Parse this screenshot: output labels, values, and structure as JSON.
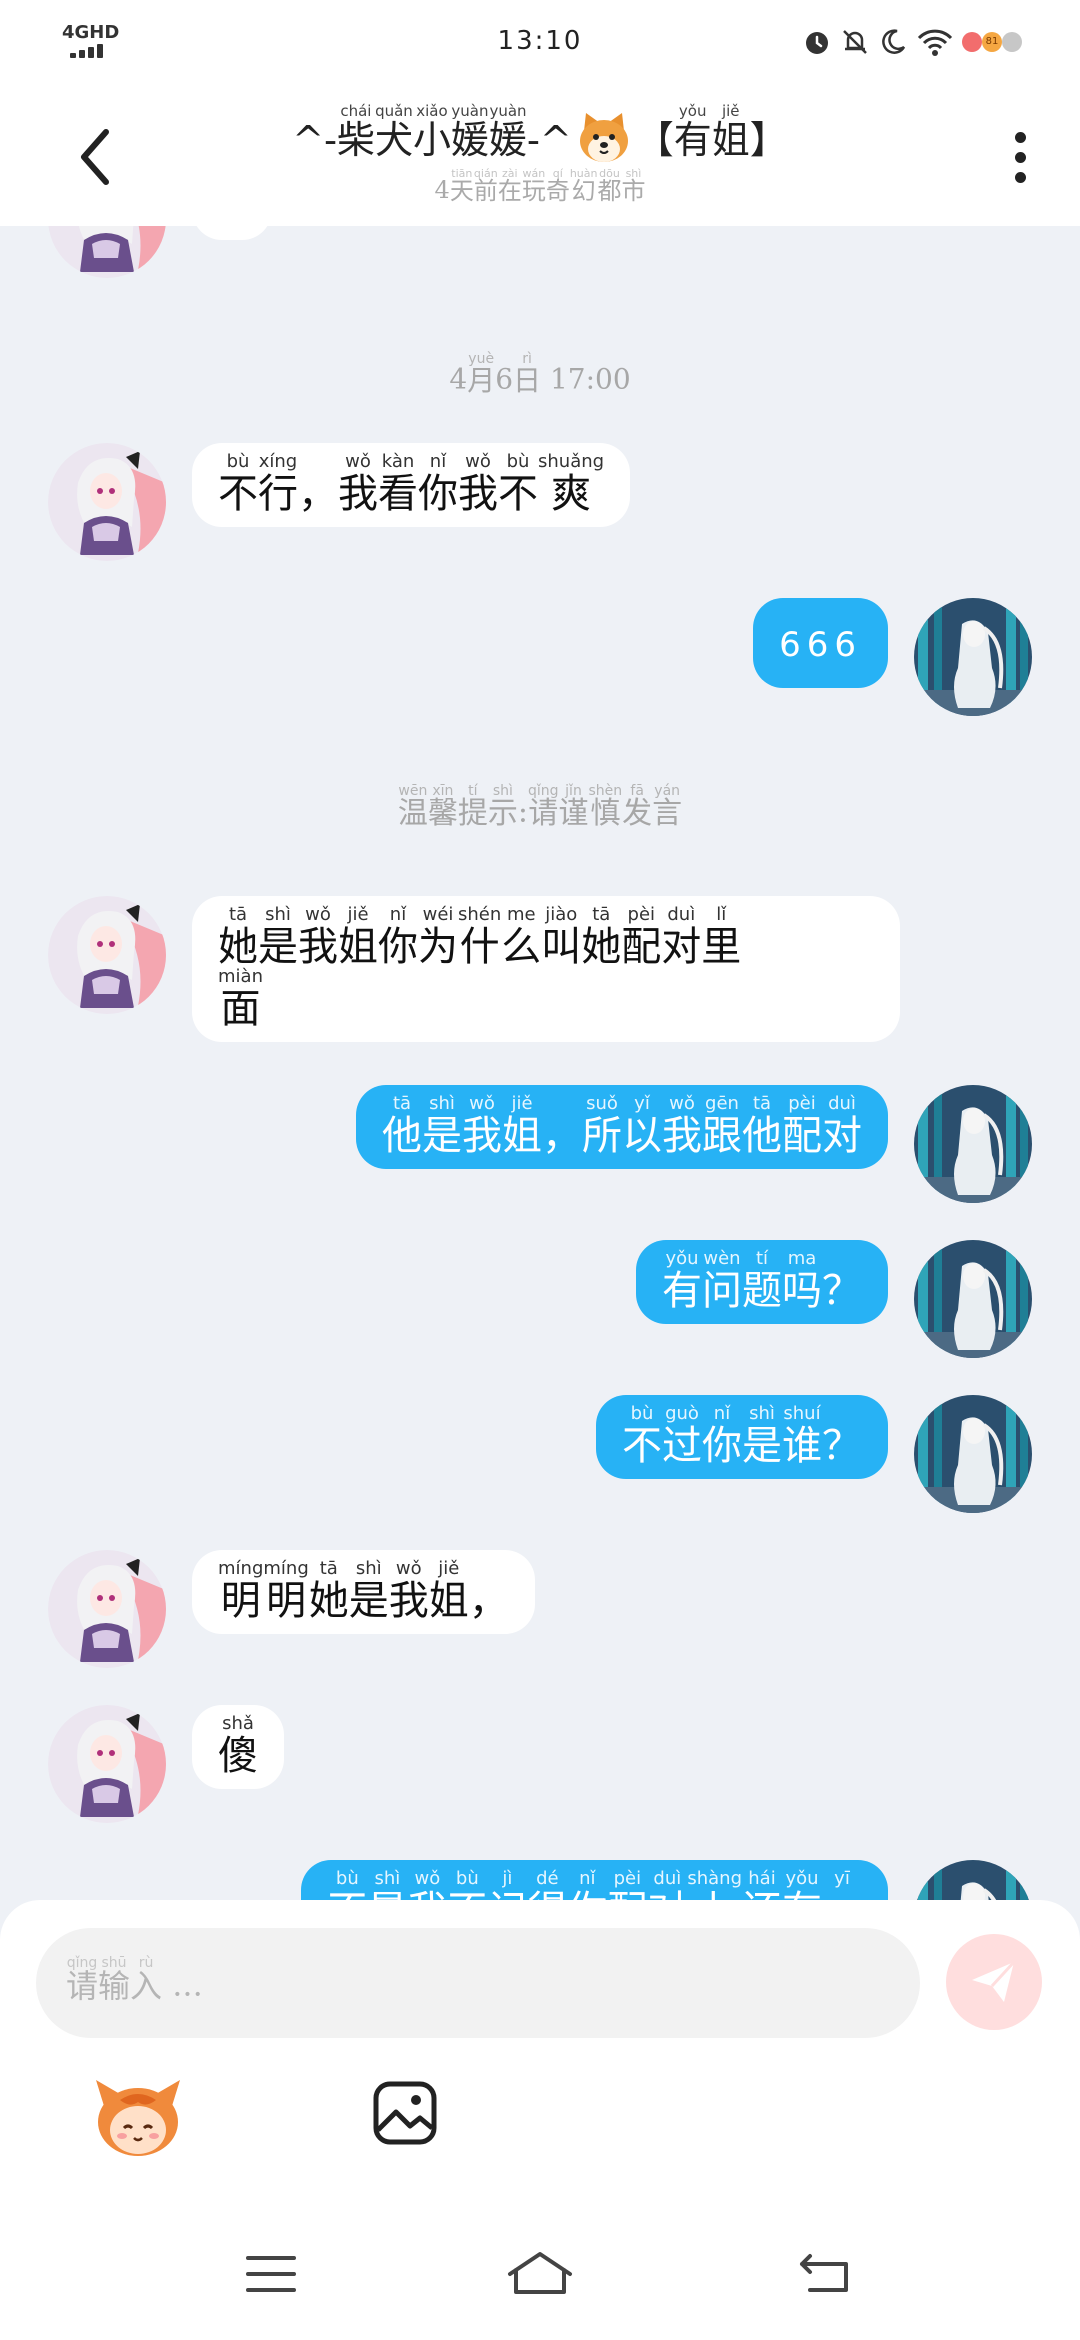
{
  "status_bar": {
    "network": "4GHD",
    "time": "13:10",
    "battery_level": "81",
    "icons": [
      "alarm-icon",
      "mute-icon",
      "moon-icon",
      "wifi-icon",
      "battery-icon"
    ]
  },
  "header": {
    "title_segments": [
      {
        "t": "^-"
      },
      {
        "t": "柴",
        "p": "chái"
      },
      {
        "t": "犬",
        "p": "quǎn"
      },
      {
        "t": "小",
        "p": "xiǎo"
      },
      {
        "t": "媛",
        "p": "yuàn"
      },
      {
        "t": "媛",
        "p": "yuàn"
      },
      {
        "t": "-^"
      },
      {
        "emoji": "dog-face-emoji"
      },
      {
        "t": "【"
      },
      {
        "t": "有",
        "p": "yǒu"
      },
      {
        "t": "姐",
        "p": "jiě"
      },
      {
        "t": "】"
      }
    ],
    "subtitle_segments": [
      {
        "t": "4"
      },
      {
        "t": "天",
        "p": "tiān"
      },
      {
        "t": "前",
        "p": "qián"
      },
      {
        "t": "在",
        "p": "zài"
      },
      {
        "t": "玩",
        "p": "wán"
      },
      {
        "t": "奇",
        "p": "qí"
      },
      {
        "t": "幻",
        "p": "huàn"
      },
      {
        "t": "都",
        "p": "dōu"
      },
      {
        "t": "市",
        "p": "shì"
      }
    ],
    "back_icon": "chevron-left-icon",
    "more_icon": "more-vertical-icon"
  },
  "chat": {
    "timestamp_segments": [
      {
        "t": "4"
      },
      {
        "t": "月",
        "p": "yuè"
      },
      {
        "t": "6"
      },
      {
        "t": "日",
        "p": "rì"
      },
      {
        "t": " 17:00"
      }
    ],
    "notice_segments": [
      {
        "t": "温",
        "p": "wēn"
      },
      {
        "t": "馨",
        "p": "xīn"
      },
      {
        "t": "提",
        "p": "tí"
      },
      {
        "t": "示",
        "p": "shì"
      },
      {
        "t": ":"
      },
      {
        "t": "请",
        "p": "qǐng"
      },
      {
        "t": "谨",
        "p": "jǐn"
      },
      {
        "t": "慎",
        "p": "shèn"
      },
      {
        "t": "发",
        "p": "fā"
      },
      {
        "t": "言",
        "p": "yán"
      }
    ],
    "messages": [
      {
        "side": "in",
        "lines": [
          [
            {
              "t": "不",
              "p": "bù"
            },
            {
              "t": "行",
              "p": "xíng"
            },
            {
              "t": "，"
            },
            {
              "t": "我",
              "p": "wǒ"
            },
            {
              "t": "看",
              "p": "kàn"
            },
            {
              "t": "你",
              "p": "nǐ"
            },
            {
              "t": "我",
              "p": "wǒ"
            },
            {
              "t": "不",
              "p": "bù"
            },
            {
              "t": "爽",
              "p": "shuǎng"
            }
          ]
        ]
      },
      {
        "side": "out",
        "text": "666"
      },
      {
        "side": "in",
        "lines": [
          [
            {
              "t": "她",
              "p": "tā"
            },
            {
              "t": "是",
              "p": "shì"
            },
            {
              "t": "我",
              "p": "wǒ"
            },
            {
              "t": "姐",
              "p": "jiě"
            },
            {
              "t": "你",
              "p": "nǐ"
            },
            {
              "t": "为",
              "p": "wéi"
            },
            {
              "t": "什",
              "p": "shén"
            },
            {
              "t": "么",
              "p": "me"
            },
            {
              "t": "叫",
              "p": "jiào"
            },
            {
              "t": "她",
              "p": "tā"
            },
            {
              "t": "配",
              "p": "pèi"
            },
            {
              "t": "对",
              "p": "duì"
            },
            {
              "t": "里",
              "p": "lǐ"
            }
          ],
          [
            {
              "t": "面",
              "p": "miàn"
            }
          ]
        ]
      },
      {
        "side": "out",
        "lines": [
          [
            {
              "t": "他",
              "p": "tā"
            },
            {
              "t": "是",
              "p": "shì"
            },
            {
              "t": "我",
              "p": "wǒ"
            },
            {
              "t": "姐",
              "p": "jiě"
            },
            {
              "t": "，"
            },
            {
              "t": "所",
              "p": "suǒ"
            },
            {
              "t": "以",
              "p": "yǐ"
            },
            {
              "t": "我",
              "p": "wǒ"
            },
            {
              "t": "跟",
              "p": "gēn"
            },
            {
              "t": "他",
              "p": "tā"
            },
            {
              "t": "配",
              "p": "pèi"
            },
            {
              "t": "对",
              "p": "duì"
            }
          ]
        ]
      },
      {
        "side": "out",
        "lines": [
          [
            {
              "t": "有",
              "p": "yǒu"
            },
            {
              "t": "问",
              "p": "wèn"
            },
            {
              "t": "题",
              "p": "tí"
            },
            {
              "t": "吗",
              "p": "ma"
            },
            {
              "t": "？"
            }
          ]
        ]
      },
      {
        "side": "out",
        "lines": [
          [
            {
              "t": "不",
              "p": "bù"
            },
            {
              "t": "过",
              "p": "guò"
            },
            {
              "t": "你",
              "p": "nǐ"
            },
            {
              "t": "是",
              "p": "shì"
            },
            {
              "t": "谁",
              "p": "shuí"
            },
            {
              "t": "？"
            }
          ]
        ]
      },
      {
        "side": "in",
        "lines": [
          [
            {
              "t": "明",
              "p": "míng"
            },
            {
              "t": "明",
              "p": "míng"
            },
            {
              "t": "她",
              "p": "tā"
            },
            {
              "t": "是",
              "p": "shì"
            },
            {
              "t": "我",
              "p": "wǒ"
            },
            {
              "t": "姐",
              "p": "jiě"
            },
            {
              "t": "，"
            }
          ]
        ]
      },
      {
        "side": "in",
        "lines": [
          [
            {
              "t": "傻",
              "p": "shǎ"
            }
          ]
        ]
      },
      {
        "side": "out",
        "lines": [
          [
            {
              "t": "不",
              "p": "bù"
            },
            {
              "t": "是",
              "p": "shì"
            },
            {
              "t": "我",
              "p": "wǒ"
            },
            {
              "t": "不",
              "p": "bù"
            },
            {
              "t": "记",
              "p": "jì"
            },
            {
              "t": "得",
              "p": "dé"
            },
            {
              "t": "你",
              "p": "nǐ"
            },
            {
              "t": "配",
              "p": "pèi"
            },
            {
              "t": "对",
              "p": "duì"
            },
            {
              "t": "上",
              "p": "shàng"
            },
            {
              "t": "还",
              "p": "hái"
            },
            {
              "t": "有",
              "p": "yǒu"
            },
            {
              "t": "一",
              "p": "yī"
            }
          ]
        ]
      }
    ]
  },
  "input": {
    "placeholder_segments": [
      {
        "t": "请",
        "p": "qǐng"
      },
      {
        "t": "输",
        "p": "shū"
      },
      {
        "t": "入",
        "p": "rù"
      },
      {
        "t": " ..."
      }
    ],
    "send_icon": "send-icon",
    "send_color": "#ffdede",
    "sticker_icon": "mascot-sticker-icon",
    "image_icon": "image-icon"
  },
  "colors": {
    "outgoing_bubble": "#27b2f5",
    "incoming_bubble": "#ffffff",
    "chat_background": "#eef1f6"
  },
  "nav_bar": {
    "icons": [
      "menu-icon",
      "home-icon",
      "back-icon"
    ]
  }
}
